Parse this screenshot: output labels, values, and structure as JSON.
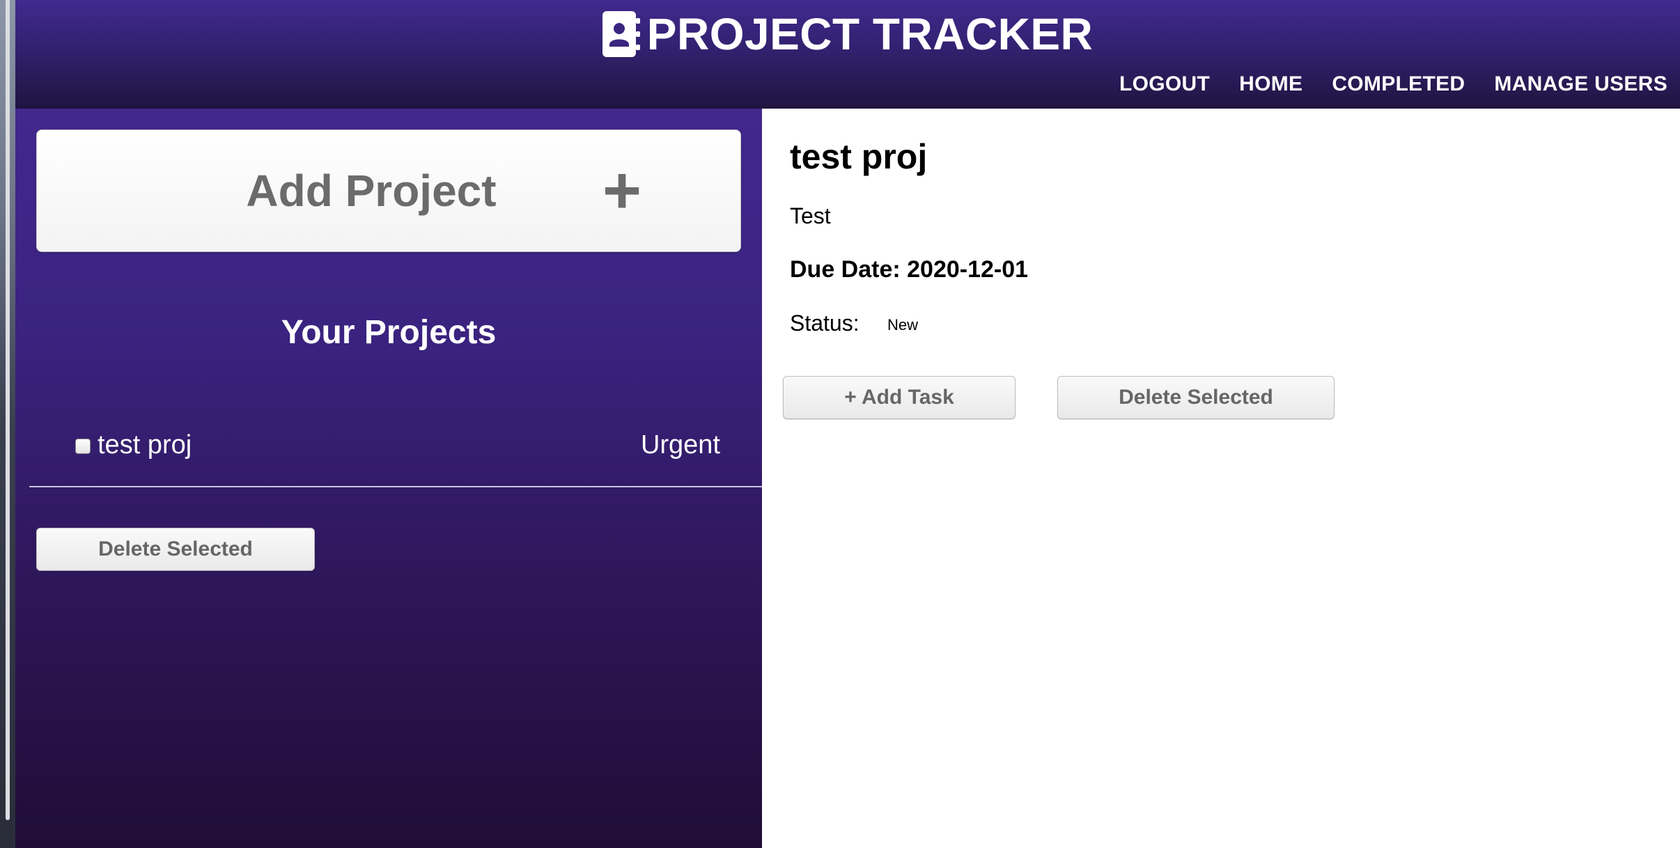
{
  "header": {
    "title": "PROJECT TRACKER",
    "brand_icon": "contact-book-icon",
    "nav": [
      {
        "label": "LOGOUT"
      },
      {
        "label": "HOME"
      },
      {
        "label": "COMPLETED"
      },
      {
        "label": "MANAGE USERS"
      }
    ]
  },
  "sidebar": {
    "add_project_label": "Add Project",
    "add_project_plus": "+",
    "heading": "Your Projects",
    "projects": [
      {
        "name": "test proj",
        "priority": "Urgent",
        "checked": false
      }
    ],
    "delete_label": "Delete Selected"
  },
  "detail": {
    "title": "test proj",
    "description": "Test",
    "due": "Due Date: 2020-12-01",
    "status_label": "Status:",
    "status_value": "New",
    "add_task_label": "+ Add Task",
    "delete_label": "Delete Selected"
  },
  "colors": {
    "header_top": "#402a8e",
    "sidebar_bottom": "#1f0d36",
    "button_text": "#666666"
  }
}
